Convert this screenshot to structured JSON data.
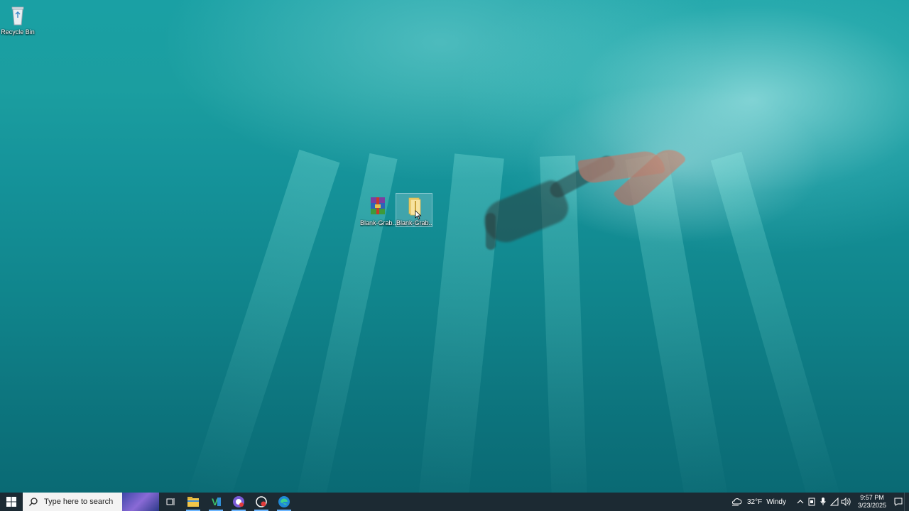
{
  "desktop": {
    "icons": [
      {
        "label": "Recycle Bin",
        "icon": "recycle-bin-icon"
      },
      {
        "label": "Blank-Grab...",
        "icon": "winrar-archive-icon"
      },
      {
        "label": "Blank-Grab...",
        "icon": "folder-icon"
      }
    ]
  },
  "taskbar": {
    "start_icon": "windows-logo-icon",
    "search_placeholder": "Type here to search",
    "apps": [
      {
        "name": "Task View",
        "icon": "task-view-icon"
      },
      {
        "name": "File Explorer",
        "icon": "file-explorer-icon"
      },
      {
        "name": "Visual Studio",
        "icon": "visual-studio-icon"
      },
      {
        "name": "Discord",
        "icon": "discord-icon"
      },
      {
        "name": "Recorder",
        "icon": "record-icon"
      },
      {
        "name": "Microsoft Edge",
        "icon": "edge-icon"
      }
    ],
    "weather": {
      "temp": "32°F",
      "condition": "Windy"
    },
    "clock": {
      "time": "9:57 PM",
      "date": "3/23/2025"
    }
  },
  "colors": {
    "taskbar_bg": "#1c2a33",
    "accent": "#6cb6ff"
  }
}
